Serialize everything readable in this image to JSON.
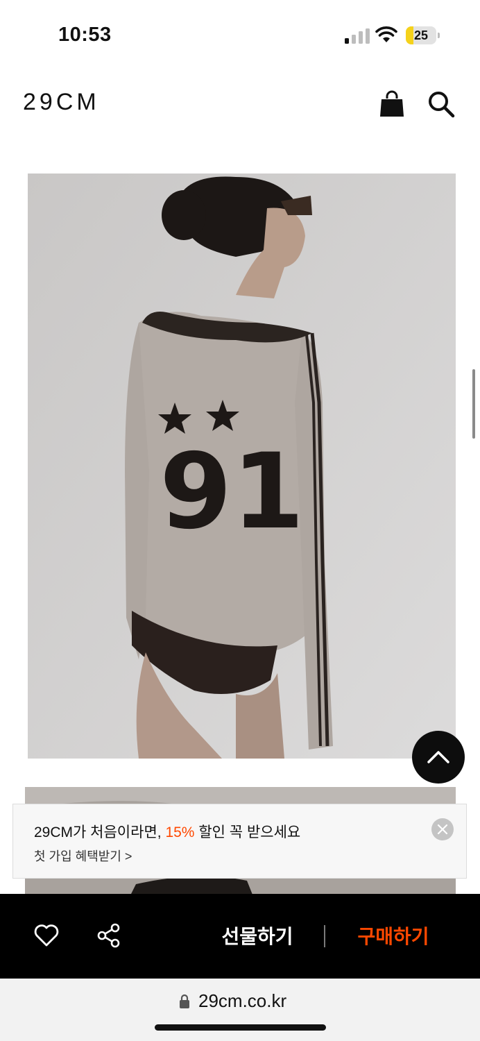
{
  "status_bar": {
    "time": "10:53",
    "battery_level": "25",
    "battery_fraction": 0.25
  },
  "header": {
    "logo": "29CM",
    "cart_icon": "shopping-bag-icon",
    "search_icon": "search-icon"
  },
  "product": {
    "jersey_number": "91"
  },
  "promo_banner": {
    "title_prefix": "29CM가 처음이라면, ",
    "title_highlight": "15%",
    "title_suffix": " 할인 꼭 받으세요",
    "subtitle": "첫 가입 혜택받기 >",
    "close_icon": "close-icon",
    "highlight_color": "#ff4800"
  },
  "action_bar": {
    "like_icon": "heart-icon",
    "share_icon": "share-icon",
    "gift_label": "선물하기",
    "buy_label": "구매하기",
    "buy_color": "#ff4800"
  },
  "url_bar": {
    "url": "29cm.co.kr",
    "lock_icon": "lock-icon"
  },
  "floating": {
    "scroll_top_icon": "chevron-up-icon"
  }
}
